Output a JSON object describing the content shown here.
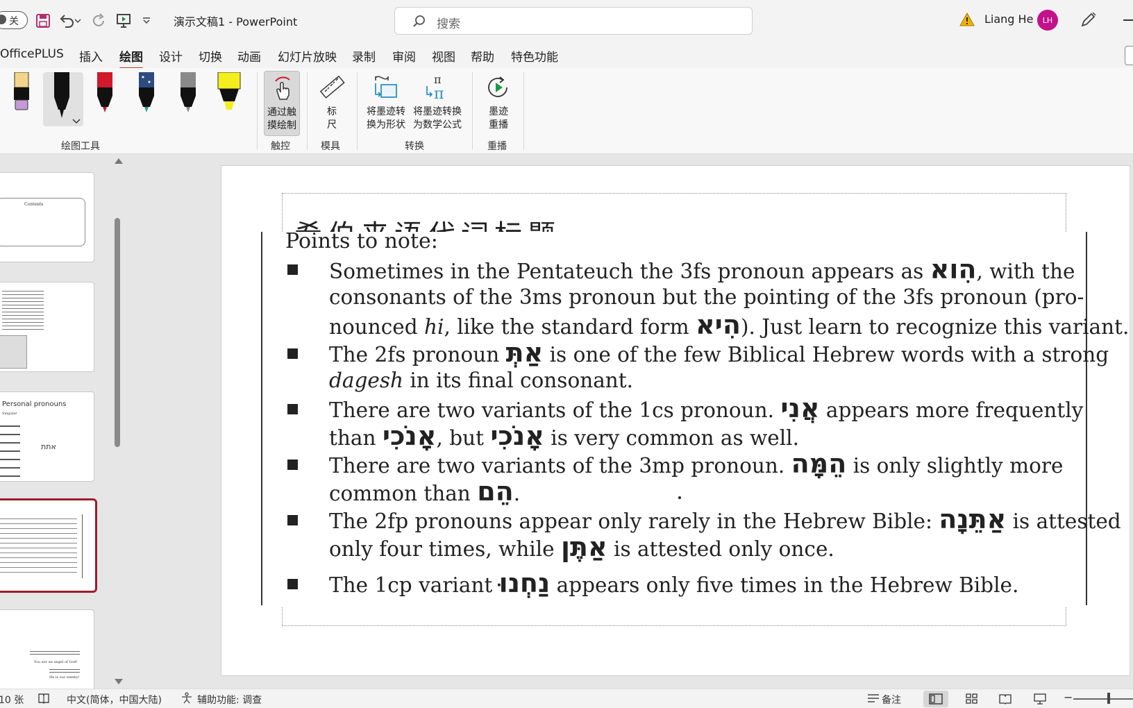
{
  "titlebar": {
    "autosave_label": "关",
    "doc_title": "演示文稿1  -  PowerPoint",
    "search_placeholder": "搜索",
    "user_name": "Liang He",
    "avatar_initials": "LH"
  },
  "menu": {
    "tabs": [
      "OfficePLUS",
      "插入",
      "绘图",
      "设计",
      "切换",
      "动画",
      "幻灯片放映",
      "录制",
      "审阅",
      "视图",
      "帮助",
      "特色功能"
    ],
    "active": "绘图"
  },
  "ribbon": {
    "groups": [
      {
        "label": "绘图工具"
      },
      {
        "label": "触控"
      },
      {
        "label": "模具"
      },
      {
        "label": "转换"
      },
      {
        "label": "重播"
      }
    ],
    "buttons": {
      "touch_draw_1": "通过触",
      "touch_draw_2": "摸绘制",
      "ruler_1": "标",
      "ruler_2": "尺",
      "ink_shape_1": "将墨迹转",
      "ink_shape_2": "换为形状",
      "ink_math_1": "将墨迹转换",
      "ink_math_2": "为数学公式",
      "ink_replay_1": "墨迹",
      "ink_replay_2": "重播"
    },
    "pens": [
      {
        "name": "highlighter-pale",
        "color": "#f3d48a"
      },
      {
        "name": "pen-black",
        "color": "#111111"
      },
      {
        "name": "pen-red",
        "color": "#d0192b"
      },
      {
        "name": "pen-galaxy",
        "color": "#2c6b8f"
      },
      {
        "name": "pen-silver",
        "color": "#8a8a8a"
      },
      {
        "name": "highlighter-yellow",
        "color": "#f5ee1e"
      }
    ]
  },
  "thumbnails": {
    "t1_title": "Contents",
    "t3_title": "Personal pronouns",
    "t3_sub": "Singular",
    "t3_word": "אתת",
    "t5_caption": "You are an angel of God!",
    "t5_caption2": "He is our enemy!"
  },
  "slide": {
    "title_ghost": "希伯来语代词标题",
    "points_title": "Points to note:",
    "bullets": [
      {
        "lines": [
          [
            "Sometimes in the Pentateuch the 3fs pronoun appears as ",
            "הִוא",
            ", with the"
          ],
          [
            "consonants of the 3ms pronoun but the pointing of the 3fs pronoun (pro-"
          ],
          [
            "nounced ",
            "hi",
            ", like the standard form ",
            "הִיא",
            "). Just learn to recognize this variant."
          ]
        ]
      },
      {
        "lines": [
          [
            "The 2fs pronoun ",
            "אַתְּ",
            " is one of the few Biblical Hebrew words with a strong"
          ],
          [
            "dagesh",
            " in its final consonant."
          ]
        ]
      },
      {
        "lines": [
          [
            "There are two variants of the 1cs pronoun. ",
            "אֲנִי",
            " appears more frequently"
          ],
          [
            "than ",
            "אָנֹכִי",
            ", but ",
            "אָנֹכִי",
            " is very common as well."
          ]
        ]
      },
      {
        "lines": [
          [
            "There are two variants of the 3mp pronoun. ",
            "הֵמָּה",
            " is only slightly more"
          ],
          [
            "common than ",
            "הֵם",
            "."
          ]
        ]
      },
      {
        "lines": [
          [
            "The 2fp pronouns appear only rarely in the Hebrew Bible: ",
            "אַתֵּנָה",
            " is attested"
          ],
          [
            "only four times, while ",
            "אַתֶּן",
            " is attested only once."
          ]
        ]
      },
      {
        "lines": [
          [
            "The 1cp variant ",
            "נַחְנוּ",
            " appears only five times in the Hebrew Bible."
          ]
        ]
      }
    ]
  },
  "status": {
    "slide_count": "10 张",
    "language": "中文(简体，中国大陆)",
    "accessibility": "辅助功能: 调查",
    "notes": "备注"
  },
  "colors": {
    "accent": "#c43e1c",
    "selected_thumb": "#9e1c2c",
    "avatar": "#c3128c"
  }
}
